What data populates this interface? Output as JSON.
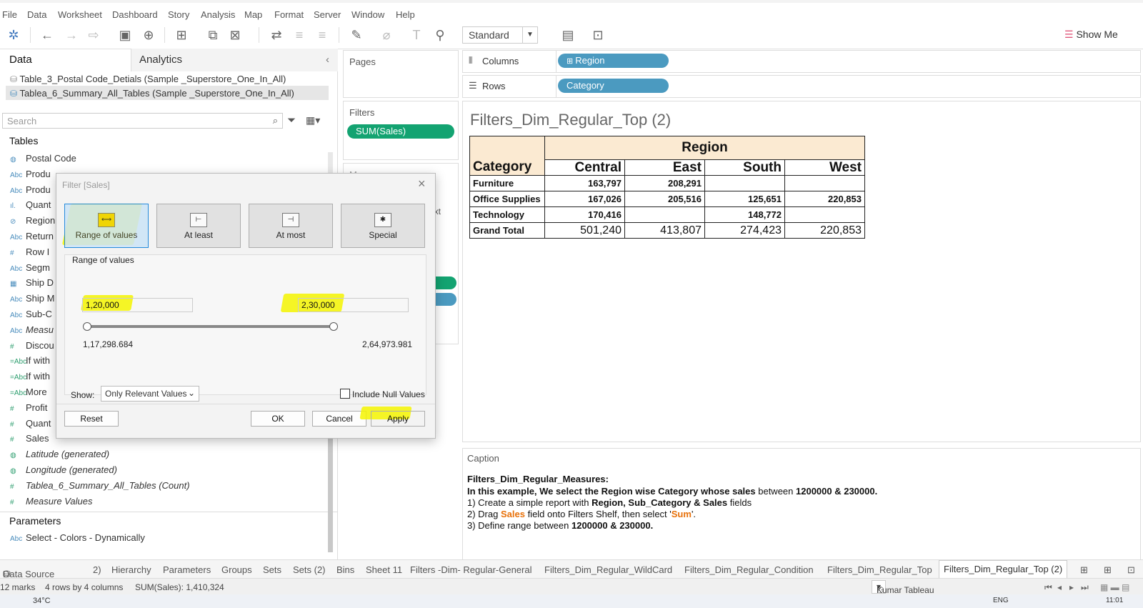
{
  "menu": [
    "File",
    "Data",
    "Worksheet",
    "Dashboard",
    "Story",
    "Analysis",
    "Map",
    "Format",
    "Server",
    "Window",
    "Help"
  ],
  "toolbar": {
    "fit_mode": "Standard",
    "show_me": "Show Me"
  },
  "left_pane": {
    "tab_data": "Data",
    "tab_analytics": "Analytics",
    "data_sources": [
      "Table_3_Postal Code_Detials (Sample _Superstore_One_In_All)",
      "Tablea_6_Summary_All_Tables (Sample _Superstore_One_In_All)"
    ],
    "search_placeholder": "Search",
    "tables_header": "Tables",
    "fields": [
      {
        "icon": "globe",
        "name": "Postal Code"
      },
      {
        "icon": "Abc",
        "name": "Produ"
      },
      {
        "icon": "Abc",
        "name": "Produ"
      },
      {
        "icon": "bars",
        "name": "Quant"
      },
      {
        "icon": "link",
        "name": "Region"
      },
      {
        "icon": "Abc",
        "name": "Return"
      },
      {
        "icon": "#",
        "name": "Row I"
      },
      {
        "icon": "Abc",
        "name": "Segm"
      },
      {
        "icon": "calendar",
        "name": "Ship D"
      },
      {
        "icon": "Abc",
        "name": "Ship M"
      },
      {
        "icon": "Abc",
        "name": "Sub-C"
      },
      {
        "icon": "Abc",
        "name": "Measu"
      },
      {
        "icon": "#",
        "name": "Discou"
      },
      {
        "icon": "=Abc",
        "name": "If with"
      },
      {
        "icon": "=Abc",
        "name": "If with"
      },
      {
        "icon": "=Abc",
        "name": "More"
      },
      {
        "icon": "#",
        "name": "Profit"
      },
      {
        "icon": "#",
        "name": "Quant"
      },
      {
        "icon": "#",
        "name": "Sales"
      },
      {
        "icon": "globe",
        "name": "Latitude (generated)"
      },
      {
        "icon": "globe",
        "name": "Longitude (generated)"
      },
      {
        "icon": "#",
        "name": "Tablea_6_Summary_All_Tables (Count)"
      },
      {
        "icon": "#",
        "name": "Measure Values"
      }
    ],
    "parameters_header": "Parameters",
    "parameter": {
      "icon": "Abc",
      "name": "Select - Colors - Dynamically"
    }
  },
  "shelves": {
    "pages": "Pages",
    "filters": "Filters",
    "filter_pill": "SUM(Sales)",
    "marks_partial": "Ma",
    "text_partial": "ext",
    "columns": "Columns",
    "columns_pill": "Region",
    "rows": "Rows",
    "rows_pill": "Category"
  },
  "view": {
    "title": "Filters_Dim_Regular_Top (2)",
    "region_header": "Region",
    "category_header": "Category",
    "columns": [
      "Central",
      "East",
      "South",
      "West"
    ],
    "rows": [
      {
        "category": "Furniture",
        "values": [
          "163,797",
          "208,291",
          "",
          ""
        ]
      },
      {
        "category": "Office Supplies",
        "values": [
          "167,026",
          "205,516",
          "125,651",
          "220,853"
        ]
      },
      {
        "category": "Technology",
        "values": [
          "170,416",
          "",
          "148,772",
          ""
        ]
      }
    ],
    "grand_total": {
      "label": "Grand Total",
      "values": [
        "501,240",
        "413,807",
        "274,423",
        "220,853"
      ]
    }
  },
  "caption": {
    "header": "Caption",
    "title": "Filters_Dim_Regular_Measures:",
    "line1_a": "In this example, We select the Region wise Category whose sales ",
    "line1_b": "between",
    "line1_c": " 1200000 & 230000.",
    "line2_a": "1) Create a simple report with ",
    "line2_b": "Region, Sub_Category & Sales",
    "line2_c": " fields",
    "line3_a": "2) Drag ",
    "line3_b": "Sales",
    "line3_c": " field onto Filters Shelf, then select '",
    "line3_d": "Sum",
    "line3_e": "'.",
    "line4_a": "3) Define range between ",
    "line4_b": "1200000 & 230000."
  },
  "dialog": {
    "title": "Filter [Sales]",
    "types": [
      "Range of values",
      "At least",
      "At most",
      "Special"
    ],
    "group_label": "Range of values",
    "min_value": "1,20,000",
    "max_value": "2,30,000",
    "range_min": "1,17,298.684",
    "range_max": "2,64,973.981",
    "range_fraction_lo": 0.0,
    "range_fraction_hi": 0.987,
    "show_label": "Show:",
    "show_value": "Only Relevant Values",
    "include_null": "Include Null Values",
    "reset": "Reset",
    "ok": "OK",
    "cancel": "Cancel",
    "apply": "Apply"
  },
  "sheet_tabs": [
    "Data Source",
    "2)",
    "Hierarchy",
    "Parameters",
    "Groups",
    "Sets",
    "Sets (2)",
    "Bins",
    "Sheet 11",
    "Filters -Dim- Regular-General",
    "Filters_Dim_Regular_WildCard",
    "Filters_Dim_Regular_Condition",
    "Filters_Dim_Regular_Top",
    "Filters_Dim_Regular_Top (2)"
  ],
  "status": {
    "marks": "12 marks",
    "dims": "4 rows by 4 columns",
    "sum": "SUM(Sales): 1,410,324",
    "user": "Kumar Tableau"
  },
  "taskbar": {
    "temp": "34°C",
    "lang": "ENG",
    "time": "11:01"
  }
}
